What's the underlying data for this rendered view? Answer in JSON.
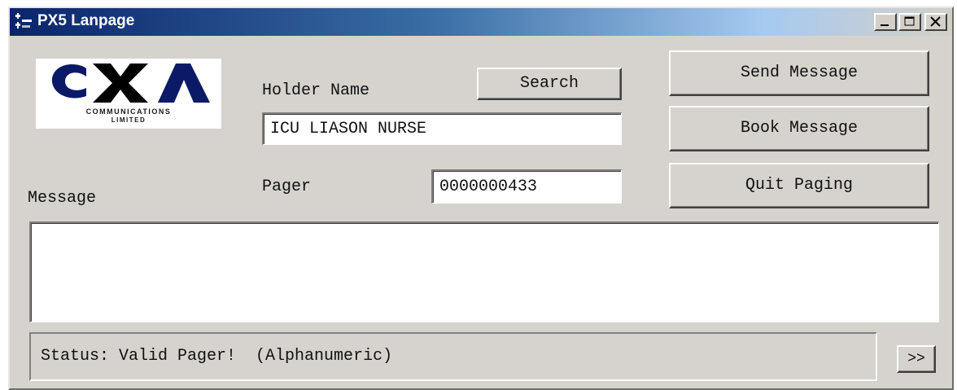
{
  "window": {
    "title": "PX5 Lanpage"
  },
  "logo": {
    "brand": "CXA",
    "line1": "COMMUNICATIONS",
    "line2": "LIMITED",
    "colors": {
      "brand_blue": "#0b1a66",
      "accent_black": "#000000"
    }
  },
  "form": {
    "holder_name_label": "Holder Name",
    "holder_name_value": "ICU LIASON NURSE",
    "search_label": "Search",
    "pager_label": "Pager",
    "pager_value": "0000000433",
    "message_label": "Message",
    "message_value": ""
  },
  "actions": {
    "send_label": "Send Message",
    "book_label": "Book Message",
    "quit_label": "Quit Paging"
  },
  "status": {
    "text": "Status: Valid Pager!  (Alphanumeric)",
    "expand_label": ">>"
  },
  "titlebar_controls": {
    "minimize_icon": "minimize-icon",
    "maximize_icon": "maximize-icon",
    "close_icon": "close-icon"
  }
}
